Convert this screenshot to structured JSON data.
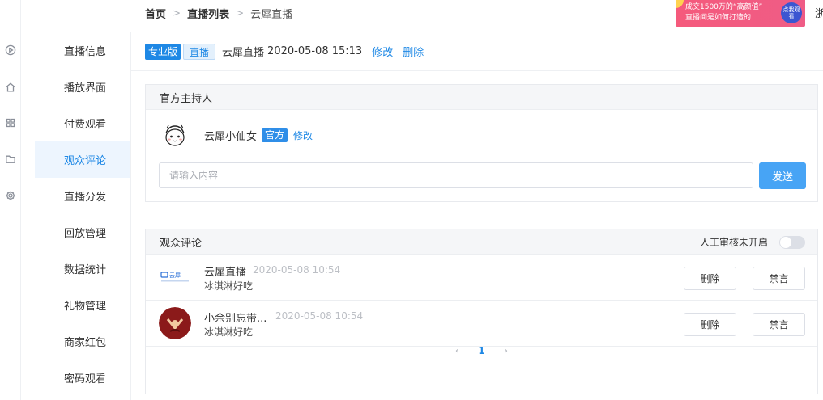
{
  "breadcrumb": {
    "home": "首页",
    "list": "直播列表",
    "current": "云犀直播"
  },
  "banner": {
    "line1": "成交1500万的“高颜值”",
    "line2": "直播间是如何打造的",
    "cta": "点我观看"
  },
  "topbar_cut_text": "浙",
  "rail_icons": [
    "play-circle-icon",
    "home-icon",
    "grid-icon",
    "folder-icon",
    "gear-icon"
  ],
  "menu": {
    "items": [
      "直播信息",
      "播放界面",
      "付费观看",
      "观众评论",
      "直播分发",
      "回放管理",
      "数据统计",
      "礼物管理",
      "商家红包",
      "密码观看"
    ],
    "active_index": 3
  },
  "title": {
    "tag_pro": "专业版",
    "tag_live": "直播",
    "name": "云犀直播",
    "datetime": "2020-05-08 15:13",
    "edit": "修改",
    "delete": "删除"
  },
  "host_panel": {
    "title": "官方主持人",
    "host_name": "云犀小仙女",
    "badge": "官方",
    "edit": "修改",
    "input_placeholder": "请输入内容",
    "send": "发送"
  },
  "comments_panel": {
    "title": "观众评论",
    "toggle_label": "人工审核未开启",
    "toggle_on": false,
    "items": [
      {
        "name": "云犀直播",
        "time": "2020-05-08 10:54",
        "text": "冰淇淋好吃",
        "delete": "删除",
        "mute": "禁言"
      },
      {
        "name": "小余别忘带...",
        "time": "2020-05-08 10:54",
        "text": "冰淇淋好吃",
        "delete": "删除",
        "mute": "禁言"
      }
    ],
    "pagination": {
      "prev": "‹",
      "current": "1",
      "next": "›"
    }
  },
  "colors": {
    "accent": "#1e88e5",
    "send_button": "#47a4f5",
    "active_menu_bg": "#edf5fe",
    "banner": "#f55a7c"
  }
}
